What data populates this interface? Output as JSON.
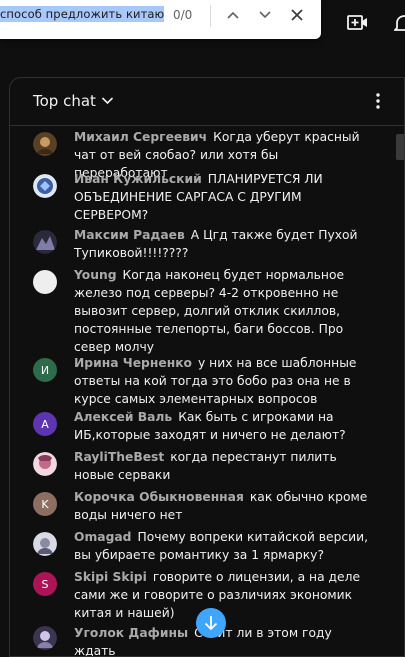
{
  "findbar": {
    "query": "способ предложить китаю",
    "count": "0/0"
  },
  "chat": {
    "title": "Top chat",
    "messages": [
      {
        "author": "Михаил Сергеевич",
        "text": "Когда уберут красный чат от вей сяобао? или хотя бы переработают",
        "avatar_color": "#6b4f2a",
        "avatar_letter": ""
      },
      {
        "author": "Иван Кужильский",
        "text": "ПЛАНИРУЕТСЯ ЛИ ОБЪЕДИНЕНИЕ САРГАСА С ДРУГИМ СЕРВЕРОМ?",
        "avatar_color": "#3b5fa0",
        "avatar_letter": ""
      },
      {
        "author": "Максим Радаев",
        "text": "А Цгд также будет Пухой Тупиковой!!!!????",
        "avatar_color": "#4a4a6a",
        "avatar_letter": ""
      },
      {
        "author": "Young",
        "text": "Когда наконец будет нормальное железо под серверы? 4-2 откровенно не вывозит сервер, долгий отклик скиллов, постоянные телепорты, баги боссов. Про север молчу",
        "avatar_color": "#eeeeee",
        "avatar_letter": ""
      },
      {
        "author": "Ирина Черненко",
        "text": "у них на все шаблонные ответы на кой тогда это бобо раз она не в курсе самых элементарных вопросов",
        "avatar_color": "#2e6b4a",
        "avatar_letter": "И"
      },
      {
        "author": "Алексей Валь",
        "text": "Как быть с игроками на ИБ,которые заходят и ничего не делают?",
        "avatar_color": "#5e35b1",
        "avatar_letter": "A"
      },
      {
        "author": "RayliTheBest",
        "text": "когда перестанут пилить новые серваки",
        "avatar_color": "#c06b8a",
        "avatar_letter": ""
      },
      {
        "author": "Корочка Обыкновенная",
        "text": "как обычно кроме воды ничего нет",
        "avatar_color": "#8d6e63",
        "avatar_letter": "K"
      },
      {
        "author": "Omagad",
        "text": "Почему вопреки китайской версии, вы убираете романтику за 1 ярмарку?",
        "avatar_color": "#9e9e9e",
        "avatar_letter": ""
      },
      {
        "author": "Skipi Skipi",
        "text": "говорите о лицензии, а на деле сами же и говорите о различиях экономик китая и нашей)",
        "avatar_color": "#ad1457",
        "avatar_letter": "S"
      },
      {
        "author": "Уголок Дафины",
        "text": "Стоит ли в этом году ждать",
        "avatar_color": "#8a7fa8",
        "avatar_letter": ""
      }
    ]
  }
}
